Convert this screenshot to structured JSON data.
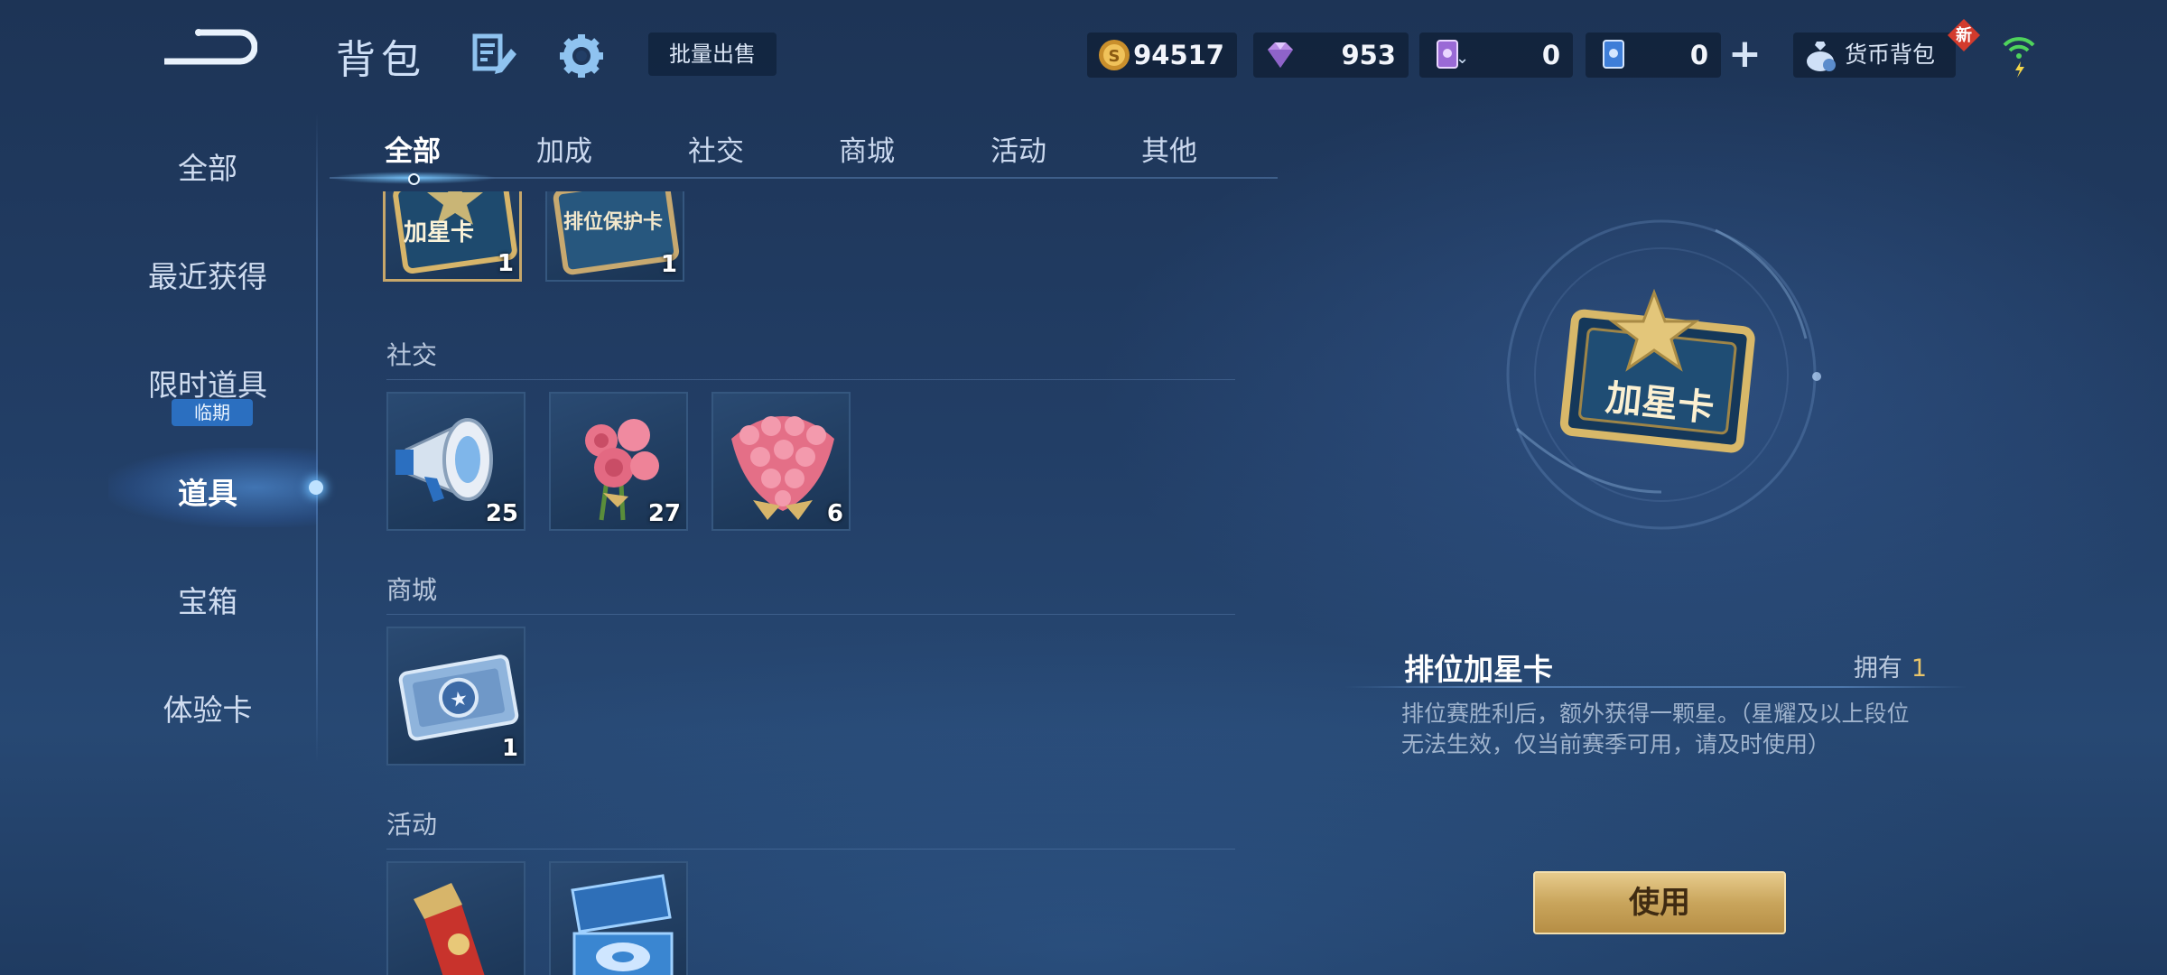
{
  "header": {
    "title": "背包",
    "bulk_sell_label": "批量出售",
    "currencies": [
      {
        "icon": "gold-coin-icon",
        "value": "94517"
      },
      {
        "icon": "diamond-icon",
        "value": "953"
      },
      {
        "icon": "purple-card-icon",
        "value": "0"
      },
      {
        "icon": "blue-card-icon",
        "value": "0"
      }
    ],
    "wallet_label": "货币背包",
    "new_badge": "新"
  },
  "sidebar": {
    "items": [
      {
        "label": "全部"
      },
      {
        "label": "最近获得"
      },
      {
        "label": "限时道具",
        "tag": "临期"
      },
      {
        "label": "道具",
        "active": true
      },
      {
        "label": "宝箱"
      },
      {
        "label": "体验卡"
      }
    ]
  },
  "tabs": [
    "全部",
    "加成",
    "社交",
    "商城",
    "活动",
    "其他"
  ],
  "sections": {
    "top_items": [
      {
        "name": "加星卡",
        "count": "1"
      },
      {
        "name": "排位保护卡",
        "count": "1"
      }
    ],
    "social": {
      "label": "社交",
      "items": [
        {
          "name": "喇叭",
          "count": "25"
        },
        {
          "name": "玫瑰花",
          "count": "27"
        },
        {
          "name": "花束",
          "count": "6"
        }
      ]
    },
    "shop": {
      "label": "商城",
      "items": [
        {
          "name": "优惠券",
          "count": "1"
        }
      ]
    },
    "activity": {
      "label": "活动",
      "items": [
        {
          "name": "卷轴"
        },
        {
          "name": "礼盒"
        }
      ]
    }
  },
  "detail": {
    "name": "排位加星卡",
    "owned_label": "拥有",
    "owned_count": "1",
    "description": "排位赛胜利后，额外获得一颗星。（星耀及以上段位无法生效，仅当前赛季可用，请及时使用）",
    "use_label": "使用"
  },
  "colors": {
    "accent_gold": "#c9a55c",
    "tab_glow": "#78c8ff"
  }
}
